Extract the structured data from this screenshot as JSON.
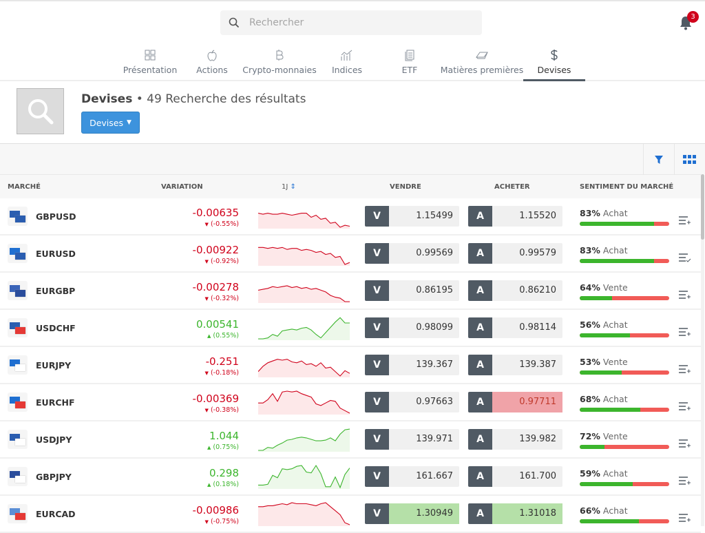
{
  "search": {
    "placeholder": "Rechercher"
  },
  "notifications": {
    "count": "3"
  },
  "tabs": [
    {
      "label": "Présentation",
      "icon": "grid-icon"
    },
    {
      "label": "Actions",
      "icon": "apple-icon"
    },
    {
      "label": "Crypto-monnaies",
      "icon": "bitcoin-icon"
    },
    {
      "label": "Indices",
      "icon": "chart-icon"
    },
    {
      "label": "ETF",
      "icon": "document-icon"
    },
    {
      "label": "Matières premières",
      "icon": "gold-bar-icon"
    },
    {
      "label": "Devises",
      "icon": "dollar-icon",
      "active": true
    }
  ],
  "header": {
    "title": "Devises",
    "results": "49 Recherche des résultats",
    "dropdown": "Devises"
  },
  "columns": {
    "market": "MARCHÉ",
    "variation": "VARIATION",
    "period": "1J",
    "sell": "VENDRE",
    "buy": "ACHETER",
    "sentiment": "SENTIMENT DU MARCHÉ"
  },
  "labels": {
    "sell_key": "V",
    "buy_key": "A"
  },
  "colors": {
    "up": "#3cb52d",
    "down": "#d0021b",
    "accent": "#3d93dd",
    "dark": "#505a64"
  },
  "rows": [
    {
      "name": "GBPUSD",
      "change": "-0.00635",
      "pct": "(-0.55%)",
      "dir": "down",
      "sell": "1.15499",
      "buy": "1.15520",
      "sent_pct": "83%",
      "sent_label": "Achat",
      "buy_share": 83,
      "watch": "add",
      "flags": [
        "#2a5db0",
        "#2a5db0"
      ],
      "spark": [
        8,
        9,
        8,
        9,
        9,
        8,
        9,
        10,
        9,
        8,
        8,
        12,
        10,
        14,
        13,
        18,
        17,
        22,
        20,
        21
      ]
    },
    {
      "name": "EURUSD",
      "change": "-0.00922",
      "pct": "(-0.92%)",
      "dir": "down",
      "sell": "0.99569",
      "buy": "0.99579",
      "sent_pct": "83%",
      "sent_label": "Achat",
      "buy_share": 83,
      "watch": "added",
      "flags": [
        "#1f6fd1",
        "#2a5db0"
      ],
      "spark": [
        5,
        5,
        6,
        5,
        6,
        5,
        7,
        6,
        6,
        8,
        7,
        8,
        10,
        9,
        12,
        11,
        15,
        14,
        22,
        20
      ]
    },
    {
      "name": "EURGBP",
      "change": "-0.00278",
      "pct": "(-0.32%)",
      "dir": "down",
      "sell": "0.86195",
      "buy": "0.86210",
      "sent_pct": "64%",
      "sent_label": "Vente",
      "buy_share": 36,
      "watch": "add",
      "flags": [
        "#3a64b8",
        "#2a4d9c"
      ],
      "spark": [
        12,
        11,
        10,
        8,
        9,
        8,
        7,
        9,
        8,
        10,
        9,
        11,
        10,
        12,
        14,
        18,
        20,
        21,
        25,
        25
      ]
    },
    {
      "name": "USDCHF",
      "change": "0.00541",
      "pct": "(0.55%)",
      "dir": "up",
      "sell": "0.98099",
      "buy": "0.98114",
      "sent_pct": "56%",
      "sent_label": "Achat",
      "buy_share": 56,
      "watch": "add",
      "flags": [
        "#2a5db0",
        "#e53935"
      ],
      "spark": [
        25,
        25,
        24,
        20,
        22,
        16,
        15,
        14,
        15,
        13,
        12,
        15,
        20,
        24,
        18,
        12,
        6,
        1,
        7,
        7
      ]
    },
    {
      "name": "EURJPY",
      "change": "-0.251",
      "pct": "(-0.18%)",
      "dir": "down",
      "sell": "139.367",
      "buy": "139.387",
      "sent_pct": "53%",
      "sent_label": "Vente",
      "buy_share": 47,
      "watch": "add",
      "flags": [
        "#1f6fd1",
        "#ffffff"
      ],
      "spark": [
        20,
        14,
        10,
        8,
        6,
        7,
        6,
        9,
        10,
        8,
        12,
        11,
        14,
        10,
        16,
        15,
        20,
        25,
        19,
        22
      ]
    },
    {
      "name": "EURCHF",
      "change": "-0.00369",
      "pct": "(-0.38%)",
      "dir": "down",
      "sell": "0.97663",
      "buy": "0.97711",
      "buy_state": "down",
      "sent_pct": "68%",
      "sent_label": "Achat",
      "buy_share": 68,
      "watch": "add",
      "flags": [
        "#1f6fd1",
        "#e53935"
      ],
      "spark": [
        14,
        14,
        10,
        3,
        12,
        1,
        0,
        1,
        0,
        3,
        5,
        7,
        15,
        17,
        14,
        11,
        12,
        20,
        23,
        26
      ]
    },
    {
      "name": "USDJPY",
      "change": "1.044",
      "pct": "(0.75%)",
      "dir": "up",
      "sell": "139.971",
      "buy": "139.982",
      "sent_pct": "72%",
      "sent_label": "Vente",
      "buy_share": 28,
      "watch": "add",
      "flags": [
        "#2a5db0",
        "#ffffff"
      ],
      "spark": [
        30,
        30,
        26,
        27,
        23,
        20,
        16,
        15,
        13,
        12,
        13,
        15,
        17,
        17,
        16,
        13,
        17,
        8,
        2,
        1
      ]
    },
    {
      "name": "GBPJPY",
      "change": "0.298",
      "pct": "(0.18%)",
      "dir": "up",
      "sell": "161.667",
      "buy": "161.700",
      "sent_pct": "59%",
      "sent_label": "Achat",
      "buy_share": 59,
      "watch": "add",
      "flags": [
        "#2a4d9c",
        "#ffffff"
      ],
      "spark": [
        24,
        24,
        23,
        12,
        15,
        4,
        5,
        4,
        1,
        0,
        8,
        9,
        0,
        10,
        26,
        26,
        14,
        27,
        11,
        3
      ]
    },
    {
      "name": "EURCAD",
      "change": "-0.00986",
      "pct": "(-0.75%)",
      "dir": "down",
      "sell": "1.30949",
      "buy": "1.31018",
      "sell_state": "up",
      "buy_state": "up",
      "sent_pct": "66%",
      "sent_label": "Achat",
      "buy_share": 66,
      "watch": "add",
      "flags": [
        "#5b8fd6",
        "#e53935"
      ],
      "spark": [
        4,
        4,
        3,
        3,
        2,
        1,
        2,
        0,
        1,
        1,
        1,
        2,
        3,
        1,
        0,
        4,
        8,
        12,
        20,
        22
      ]
    }
  ]
}
